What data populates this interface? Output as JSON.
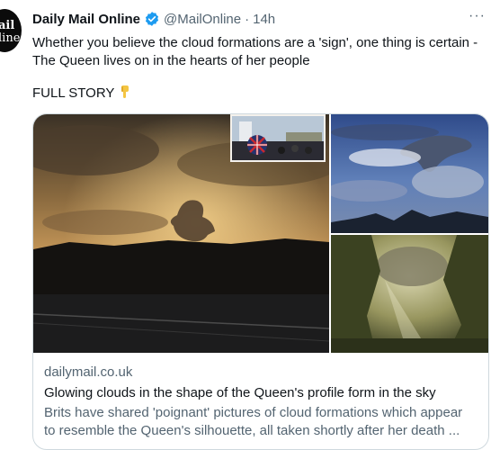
{
  "tweet": {
    "avatar_text_line1": "ail",
    "avatar_text_line2": "line",
    "display_name": "Daily Mail Online",
    "handle": "@MailOnline",
    "separator": "·",
    "time": "14h",
    "more_label": "···",
    "text_line1": "Whether you believe the cloud formations are a 'sign', one thing is certain -",
    "text_line2": "The Queen lives on in the hearts of her people",
    "cta": "FULL STORY",
    "cta_icon": "backhand-index-pointing-down-icon"
  },
  "card": {
    "domain": "dailymail.co.uk",
    "title": "Glowing clouds in the shape of the Queen's profile form in the sky",
    "description_line1": "Brits have shared 'poignant' pictures of cloud formations which appear",
    "description_line2": "to resemble the Queen's silhouette, all taken shortly after her death ..."
  },
  "colors": {
    "verified_blue": "#1d9bf0",
    "text_primary": "#0f1419",
    "text_secondary": "#536471",
    "card_border": "#cfd9de"
  }
}
